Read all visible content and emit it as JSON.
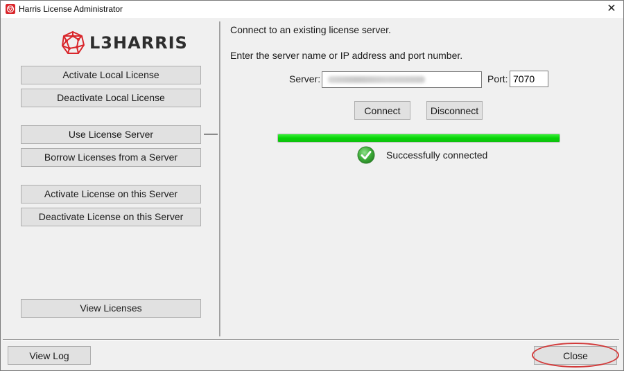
{
  "window": {
    "title": "Harris License Administrator",
    "close_glyph": "✕"
  },
  "logo": {
    "wordmark": "L3HARRIS",
    "brand_color": "#d9262b"
  },
  "sidebar": {
    "buttons": [
      {
        "label": "Activate Local License"
      },
      {
        "label": "Deactivate Local License"
      },
      {
        "label": "Use License Server",
        "selected": true
      },
      {
        "label": "Borrow Licenses from a Server"
      },
      {
        "label": "Activate License on this Server"
      },
      {
        "label": "Deactivate License on this Server"
      },
      {
        "label": "View Licenses"
      }
    ]
  },
  "main": {
    "heading": "Connect to an existing license server.",
    "instruction": "Enter the server name or IP address and port number.",
    "server_label": "Server:",
    "server_value": "",
    "server_value_redacted": true,
    "port_label": "Port:",
    "port_value": "7070",
    "connect_label": "Connect",
    "disconnect_label": "Disconnect",
    "progress_percent": 100,
    "progress_color": "#06d406",
    "status_icon": "check-circle-icon",
    "status_text": "Successfully connected"
  },
  "footer": {
    "view_log_label": "View Log",
    "close_label": "Close",
    "highlight_color": "#d23a3a"
  }
}
